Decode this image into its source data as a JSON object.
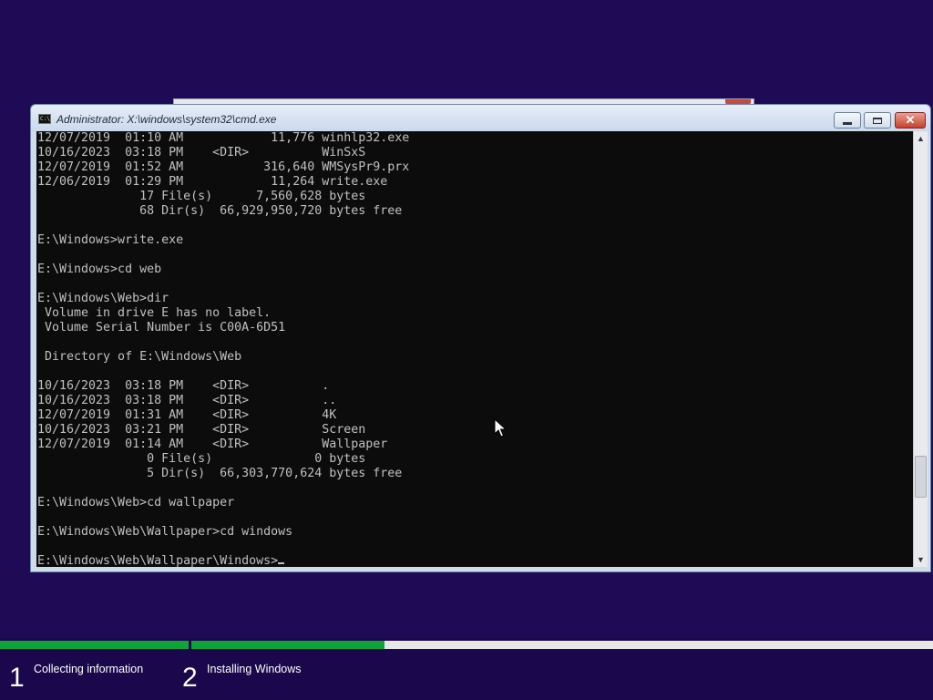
{
  "window": {
    "title": "Administrator: X:\\windows\\system32\\cmd.exe",
    "icon": "cmd-icon",
    "icon_text": "C:\\",
    "controls": {
      "minimize": "minimize-icon",
      "maximize": "maximize-icon",
      "close_label": "✕"
    }
  },
  "console": {
    "lines": [
      "12/07/2019  01:10 AM            11,776 winhlp32.exe",
      "10/16/2023  03:18 PM    <DIR>          WinSxS",
      "12/07/2019  01:52 AM           316,640 WMSysPr9.prx",
      "12/06/2019  01:29 PM            11,264 write.exe",
      "              17 File(s)      7,560,628 bytes",
      "              68 Dir(s)  66,929,950,720 bytes free",
      "",
      "E:\\Windows>write.exe",
      "",
      "E:\\Windows>cd web",
      "",
      "E:\\Windows\\Web>dir",
      " Volume in drive E has no label.",
      " Volume Serial Number is C00A-6D51",
      "",
      " Directory of E:\\Windows\\Web",
      "",
      "10/16/2023  03:18 PM    <DIR>          .",
      "10/16/2023  03:18 PM    <DIR>          ..",
      "12/07/2019  01:31 AM    <DIR>          4K",
      "10/16/2023  03:21 PM    <DIR>          Screen",
      "12/07/2019  01:14 AM    <DIR>          Wallpaper",
      "               0 File(s)              0 bytes",
      "               5 Dir(s)  66,303,770,624 bytes free",
      "",
      "E:\\Windows\\Web>cd wallpaper",
      "",
      "E:\\Windows\\Web\\Wallpaper>cd windows",
      ""
    ],
    "prompt": "E:\\Windows\\Web\\Wallpaper\\Windows>"
  },
  "scrollbar": {
    "up": "▲",
    "down": "▼"
  },
  "setup": {
    "steps": [
      {
        "number": "1",
        "label": "Collecting information",
        "progress": 1.0
      },
      {
        "number": "2",
        "label": "Installing Windows",
        "progress": 0.26
      }
    ]
  },
  "colors": {
    "background": "#1f0a55",
    "progress_fill": "#0fa43a",
    "console_bg": "#0c0c0c",
    "console_text": "#c0c0c0"
  }
}
